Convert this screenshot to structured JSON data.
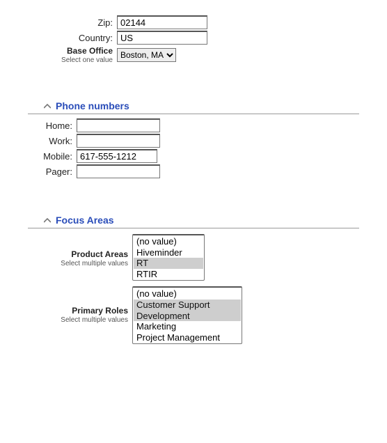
{
  "address": {
    "zip_label": "Zip:",
    "zip_value": "02144",
    "country_label": "Country:",
    "country_value": "US",
    "base_office_label": "Base Office",
    "base_office_hint": "Select one value",
    "base_office_options": [
      "Boston, MA"
    ],
    "base_office_selected": "Boston, MA"
  },
  "sections": {
    "phone_title": "Phone numbers",
    "focus_title": "Focus Areas"
  },
  "phones": {
    "home_label": "Home:",
    "home_value": "",
    "work_label": "Work:",
    "work_value": "",
    "mobile_label": "Mobile:",
    "mobile_value": "617-555-1212",
    "pager_label": "Pager:",
    "pager_value": ""
  },
  "focus": {
    "product_areas_label": "Product Areas",
    "product_areas_hint": "Select multiple values",
    "product_areas_options": [
      "(no value)",
      "Hiveminder",
      "RT",
      "RTIR"
    ],
    "product_areas_selected": [
      "RT"
    ],
    "primary_roles_label": "Primary Roles",
    "primary_roles_hint": "Select multiple values",
    "primary_roles_options": [
      "(no value)",
      "Customer Support",
      "Development",
      "Marketing",
      "Project Management"
    ],
    "primary_roles_selected": [
      "Customer Support",
      "Development"
    ]
  }
}
